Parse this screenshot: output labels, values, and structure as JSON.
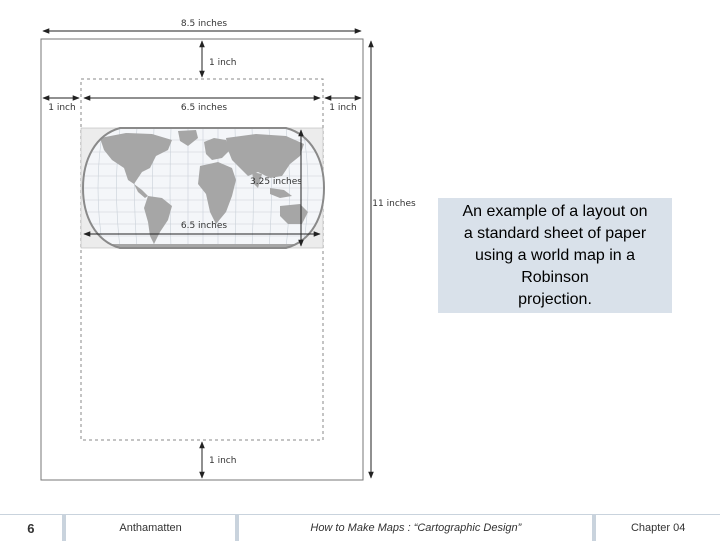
{
  "dimensions": {
    "page_width": "8.5 inches",
    "top_margin": "1 inch",
    "left_margin": "1 inch",
    "right_margin": "1 inch",
    "content_width": "6.5 inches",
    "map_height": "3.25 inches",
    "map_width": "6.5 inches",
    "page_height": "11 inches",
    "bottom_margin": "1 inch"
  },
  "caption": {
    "line1": "An example of a layout on",
    "line2": "a standard sheet of paper",
    "line3": "using a world map in a",
    "line4": "Robinson",
    "line5": "projection."
  },
  "footer": {
    "page_number": "6",
    "author": "Anthamatten",
    "book": "How to Make Maps : “Cartographic Design”",
    "chapter": "Chapter 04"
  },
  "colors": {
    "caption_bg": "#d9e1ea",
    "footer_border": "#c9d3dd",
    "map_land": "#a6a6a6",
    "map_ocean": "#f4f6f9"
  }
}
